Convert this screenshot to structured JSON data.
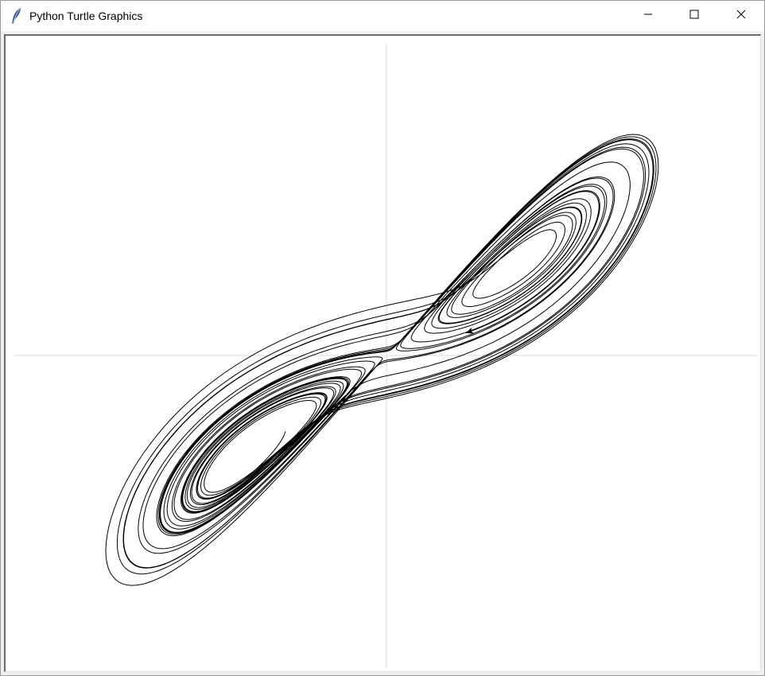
{
  "window": {
    "title": "Python Turtle Graphics",
    "icon": "feather-icon"
  },
  "titlebar_buttons": {
    "minimize": "minimize-icon",
    "maximize": "maximize-icon",
    "close": "close-icon"
  },
  "canvas": {
    "background": "#ffffff",
    "stroke": "#000000",
    "axis_color": "#d9d9d9",
    "drawing": "lorenz-attractor-trajectory"
  }
}
